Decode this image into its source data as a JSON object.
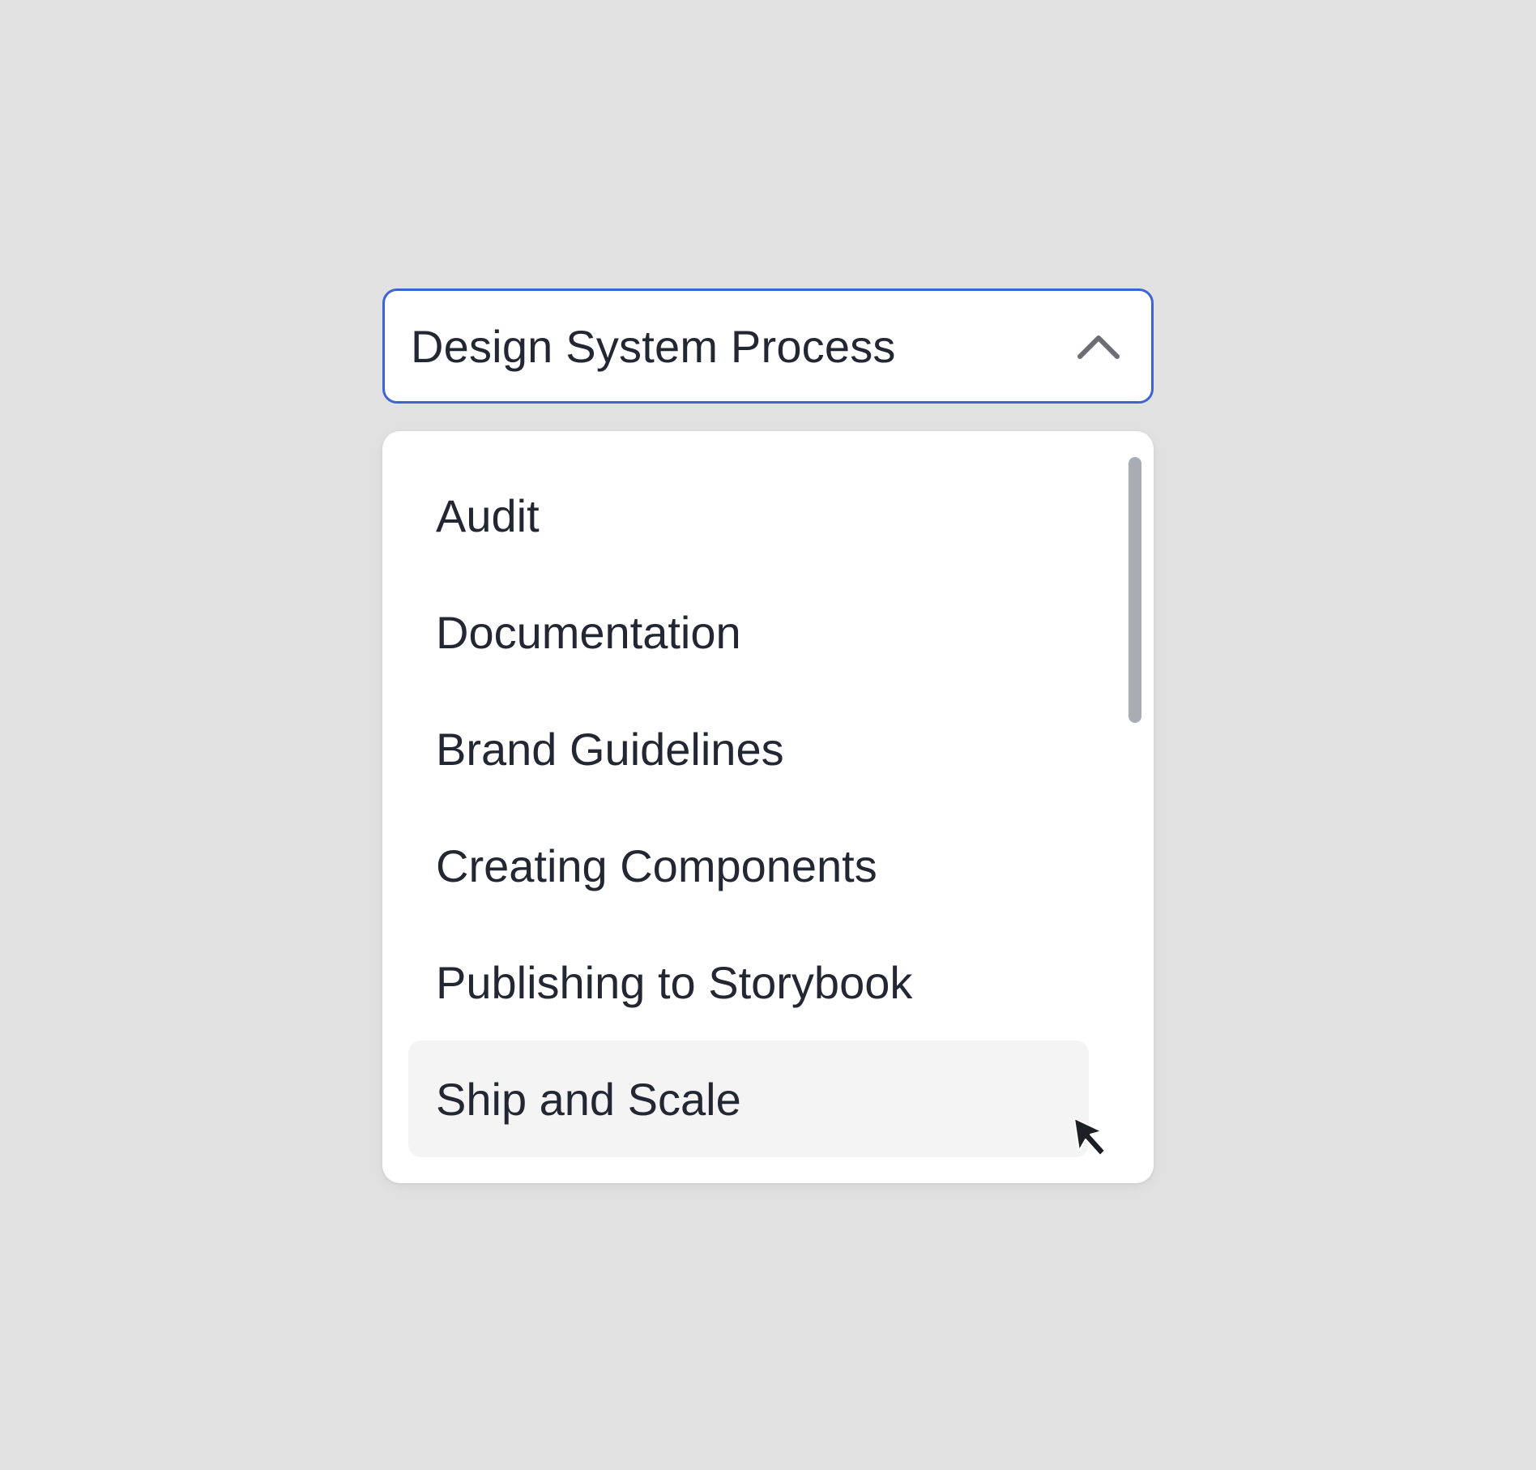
{
  "select": {
    "value": "Design System Process",
    "border_color": "#3d63d6",
    "indicator_icon": "chevron-up-icon",
    "expanded": true
  },
  "menu": {
    "items": [
      {
        "label": "Audit"
      },
      {
        "label": "Documentation"
      },
      {
        "label": "Brand Guidelines"
      },
      {
        "label": "Creating Components"
      },
      {
        "label": "Publishing to Storybook"
      },
      {
        "label": "Ship and Scale",
        "hovered": true
      }
    ],
    "hover_background": "#f4f4f4",
    "text_color": "#232733"
  },
  "colors": {
    "page_background": "#e1e1e1",
    "surface": "#ffffff",
    "scrollbar_thumb": "#a8acb3",
    "chevron": "#6b6e74"
  },
  "pointer": {
    "icon": "mouse-pointer-icon"
  }
}
